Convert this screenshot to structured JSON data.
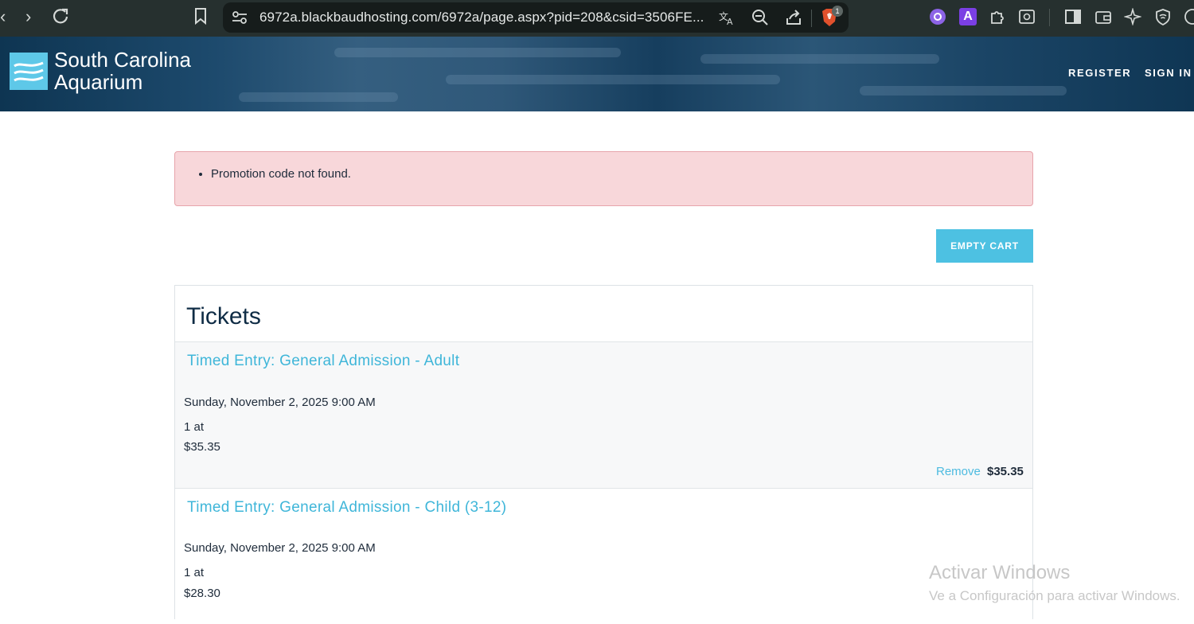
{
  "browser": {
    "url": "6972a.blackbaudhosting.com/6972a/page.aspx?pid=208&csid=3506FE...",
    "brave_badge": "1",
    "extension_letter": "A"
  },
  "header": {
    "logo_line1": "South Carolina",
    "logo_line2": "Aquarium",
    "nav": {
      "register": "REGISTER",
      "sign_in": "SIGN IN"
    }
  },
  "alert": {
    "message": "Promotion code not found."
  },
  "cart": {
    "empty_button": "EMPTY CART",
    "section_title": "Tickets",
    "items": [
      {
        "name": "Timed Entry: General Admission - Adult",
        "date": "Sunday, November 2, 2025 9:00 AM",
        "qty": "1 at",
        "unit_price": "$35.35",
        "remove_label": "Remove",
        "line_total": "$35.35"
      },
      {
        "name": "Timed Entry: General Admission - Child (3-12)",
        "date": "Sunday, November 2, 2025 9:00 AM",
        "qty": "1 at",
        "unit_price": "$28.30"
      }
    ]
  },
  "watermark": {
    "line1": "Activar Windows",
    "line2": "Ve a Configuración para activar Windows."
  },
  "colors": {
    "accent": "#4dc1e2",
    "link": "#3fb6d9",
    "alert_bg": "#f8d7da",
    "header_dark": "#0f3654"
  }
}
